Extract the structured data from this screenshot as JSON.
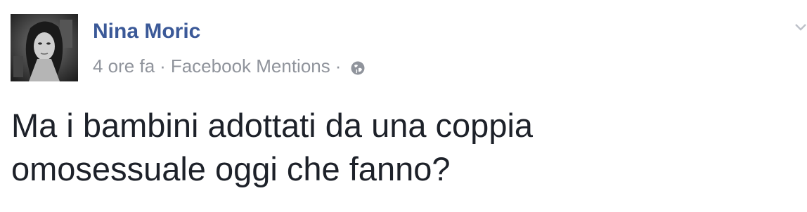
{
  "post": {
    "author": "Nina Moric",
    "timestamp": "4 ore fa",
    "separator": "·",
    "source": "Facebook Mentions",
    "privacy_icon": "globe-icon",
    "menu_icon": "chevron-down-icon",
    "message_lines": [
      "Ma i bambini adottati da una coppia",
      "omosessuale oggi che fanno?"
    ]
  },
  "colors": {
    "author_link": "#3b5998",
    "meta_text": "#90949c",
    "body_text": "#1d2129"
  }
}
